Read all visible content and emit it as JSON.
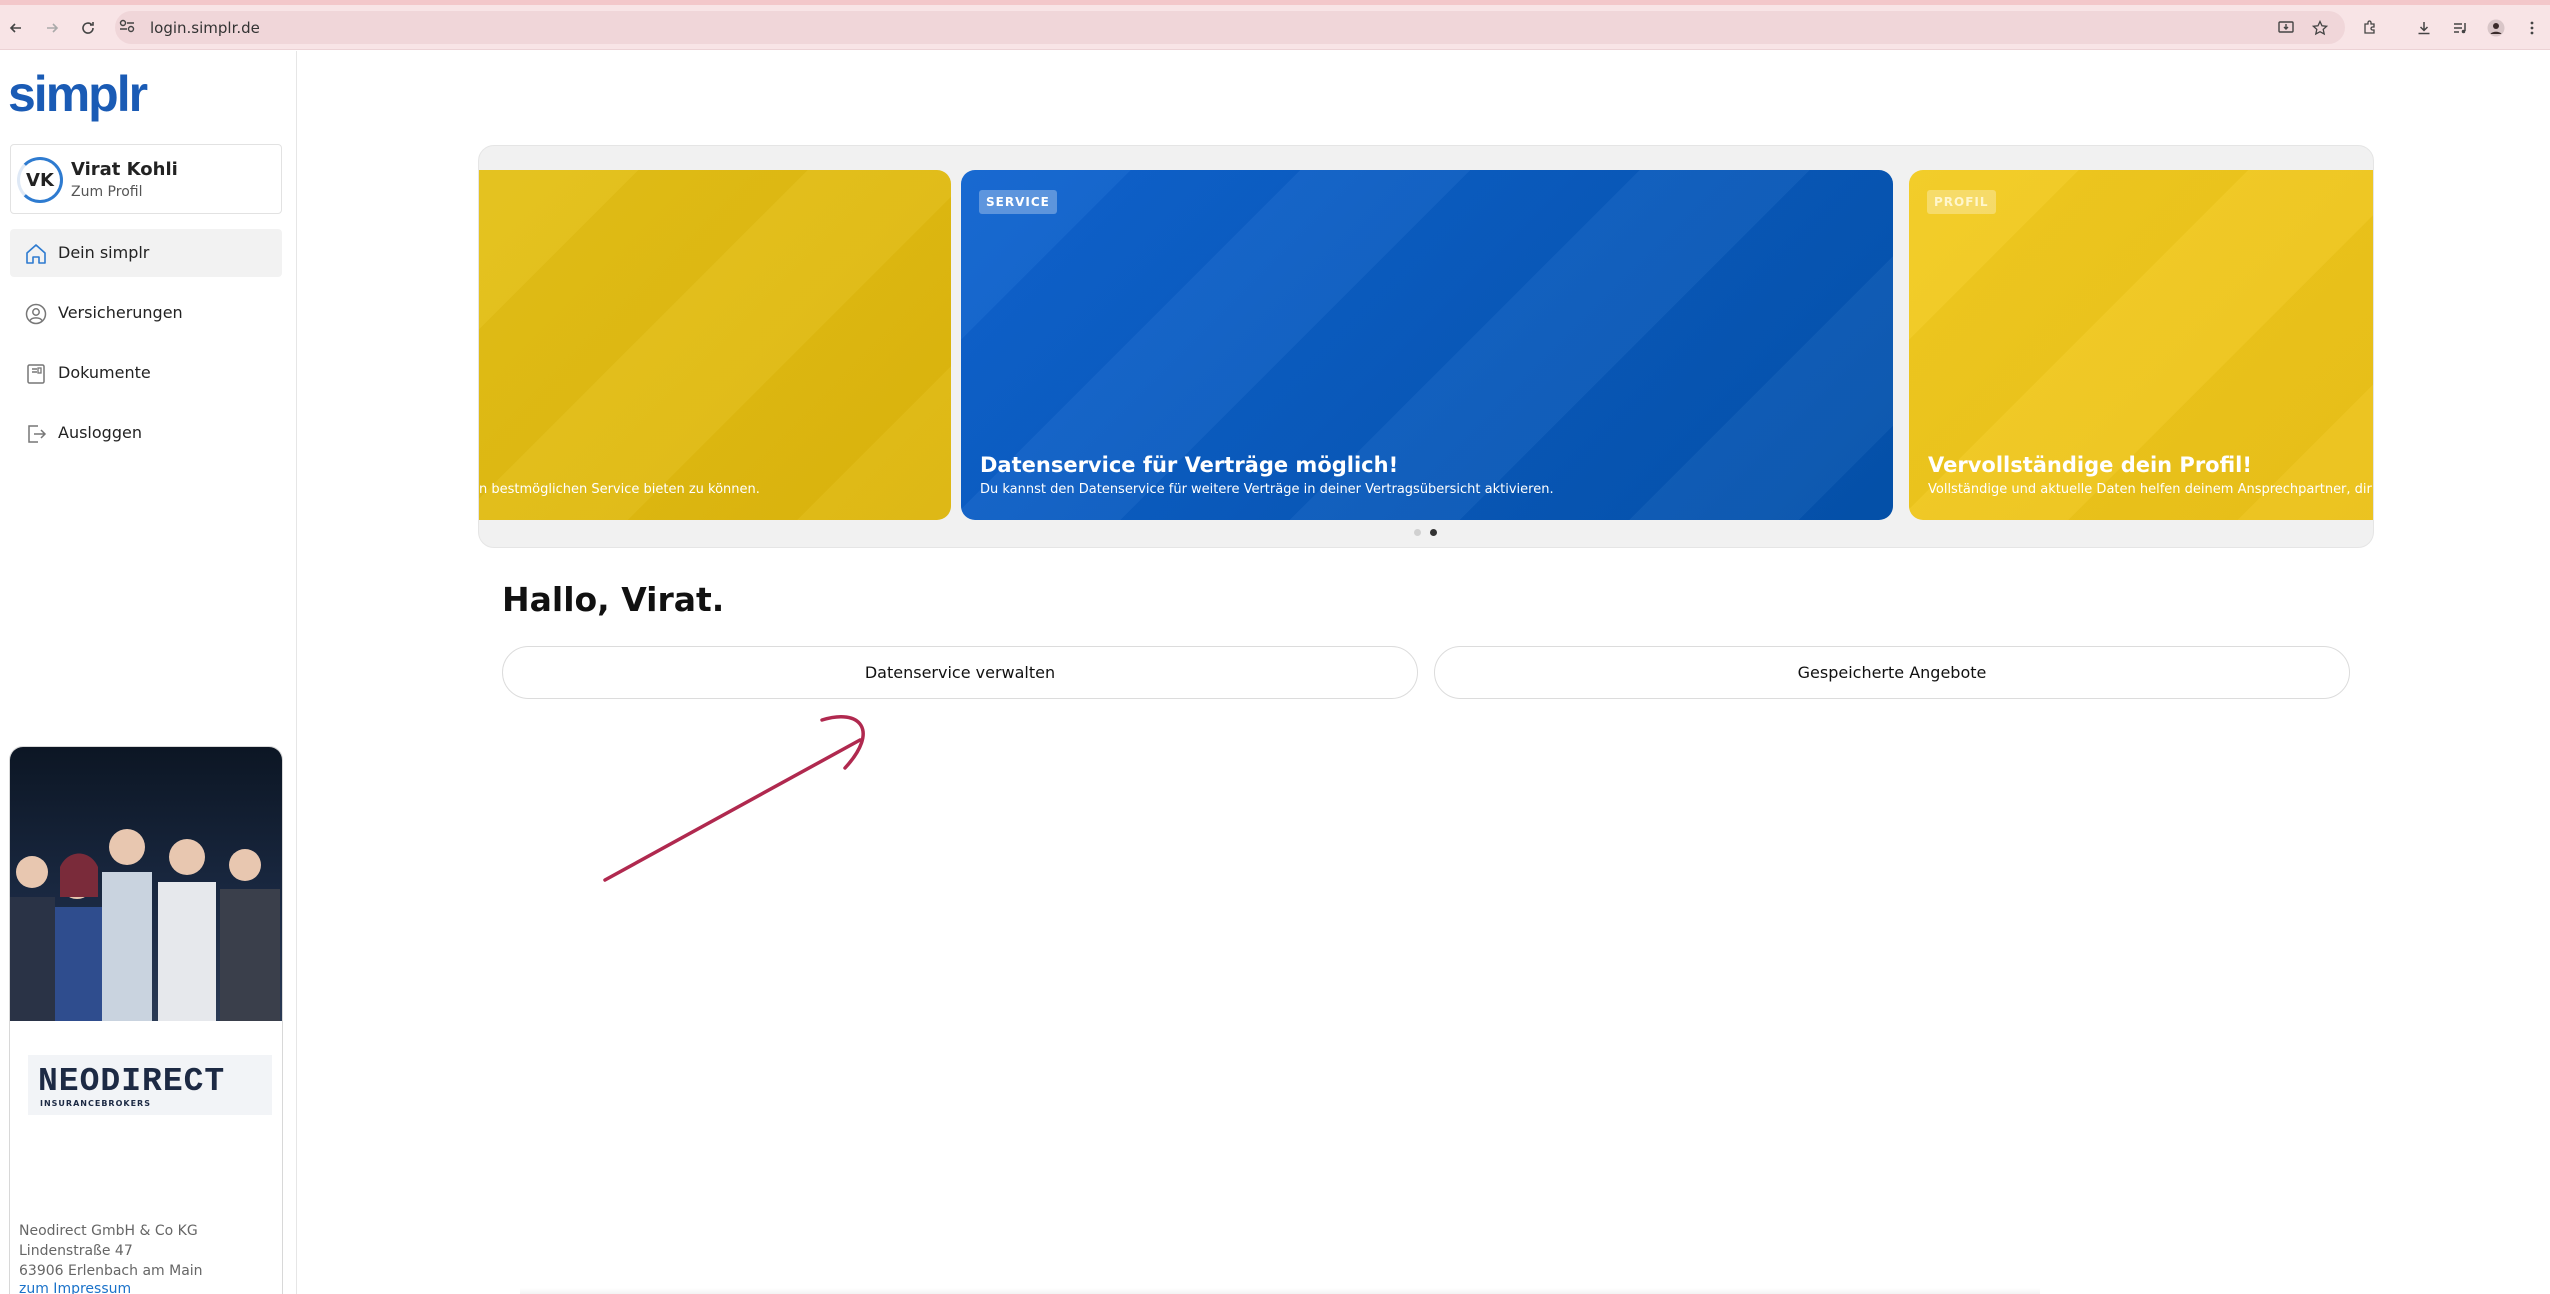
{
  "browser": {
    "url": "login.simplr.de"
  },
  "sidebar": {
    "logo": "simplr",
    "profile": {
      "initials": "VK",
      "name": "Virat Kohli",
      "subtitle": "Zum Profil"
    },
    "nav": [
      {
        "label": "Dein simplr",
        "icon": "home-icon",
        "active": true
      },
      {
        "label": "Versicherungen",
        "icon": "user-circle-icon",
        "active": false
      },
      {
        "label": "Dokumente",
        "icon": "document-icon",
        "active": false
      },
      {
        "label": "Ausloggen",
        "icon": "logout-icon",
        "active": false
      }
    ],
    "advisor": {
      "brand": "NEODIRECT",
      "brand_sub": "INSURANCEBROKERS",
      "company": "Neodirect GmbH & Co KG",
      "street": "Lindenstraße 47",
      "city": "63906 Erlenbach am Main",
      "imprint_link": "zum Impressum"
    }
  },
  "carousel": {
    "slides": [
      {
        "tag": "",
        "title": "",
        "text": "n bestmöglichen Service bieten zu können.",
        "color": "#e0bd14"
      },
      {
        "tag": "SERVICE",
        "title": "Datenservice für Verträge möglich!",
        "text": "Du kannst den Datenservice für weitere Verträge in deiner Vertragsübersicht aktivieren.",
        "color": "#0a5bc0"
      },
      {
        "tag": "PROFIL",
        "title": "Vervollständige dein Profil!",
        "text": "Vollständige und aktuelle Daten helfen deinem Ansprechpartner, dir den",
        "color": "#f0c81e"
      }
    ],
    "active_dot": 1,
    "dot_count": 2
  },
  "main": {
    "greeting": "Hallo, Virat.",
    "buttons": [
      "Datenservice verwalten",
      "Gespeicherte Angebote"
    ]
  },
  "colors": {
    "accent": "#1a5bb5",
    "annotation_arrow": "#b0294f"
  }
}
